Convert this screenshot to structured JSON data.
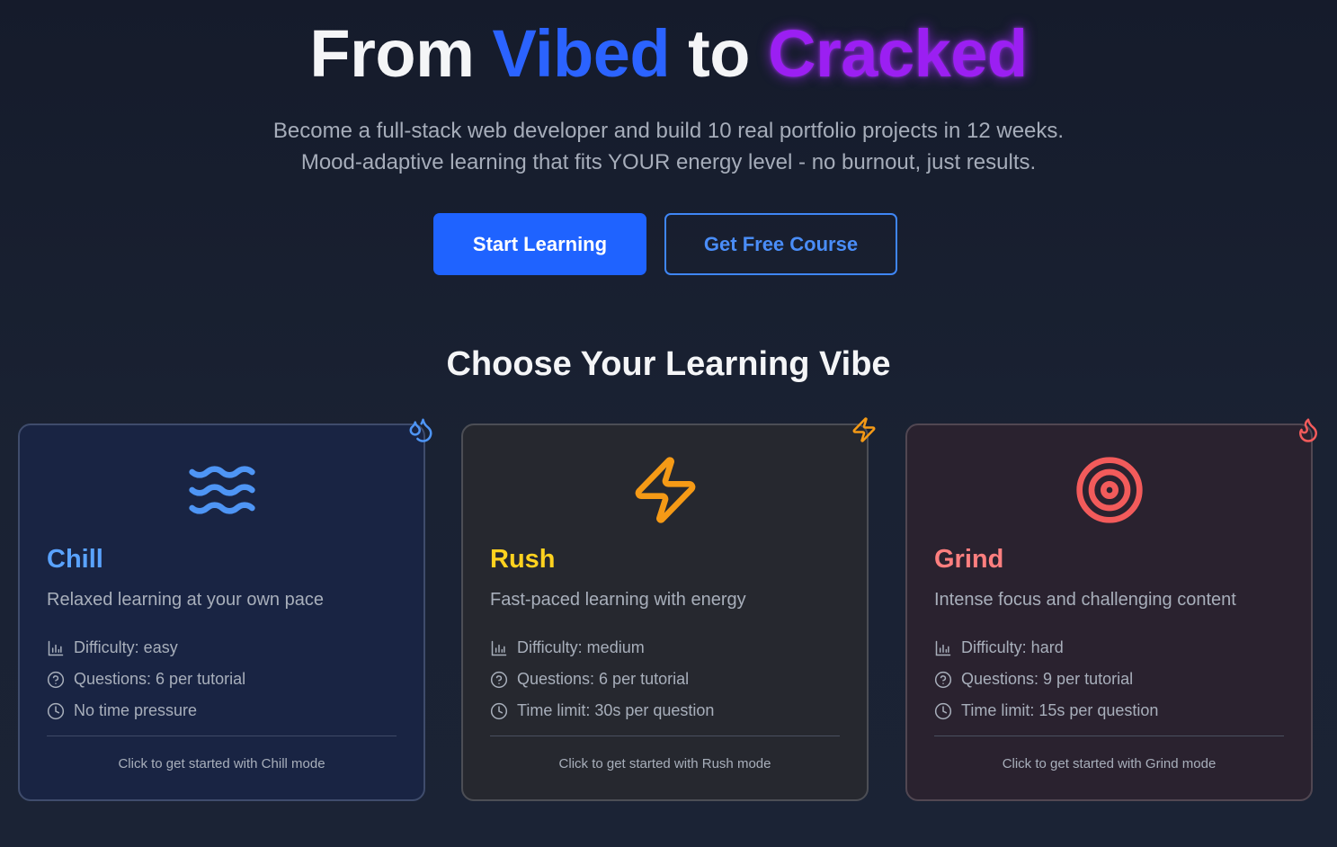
{
  "hero": {
    "title_part1": "From",
    "title_part2": "Vibed",
    "title_part3": "to",
    "title_part4": "Cracked",
    "subtitle_line1": "Become a full-stack web developer and build 10 real portfolio projects in 12 weeks.",
    "subtitle_line2": "Mood-adaptive learning that fits YOUR energy level - no burnout, just results.",
    "primary_button": "Start Learning",
    "secondary_button": "Get Free Course"
  },
  "section": {
    "title": "Choose Your Learning Vibe"
  },
  "modes": [
    {
      "name": "Chill",
      "description": "Relaxed learning at your own pace",
      "difficulty": "Difficulty: easy",
      "questions": "Questions: 6 per tutorial",
      "time": "No time pressure",
      "cta": "Click to get started with Chill mode",
      "icon": "waves-icon",
      "corner_icon": "droplets-icon",
      "accent": "#5aa3ff"
    },
    {
      "name": "Rush",
      "description": "Fast-paced learning with energy",
      "difficulty": "Difficulty: medium",
      "questions": "Questions: 6 per tutorial",
      "time": "Time limit: 30s per question",
      "cta": "Click to get started with Rush mode",
      "icon": "lightning-icon",
      "corner_icon": "lightning-icon",
      "accent": "#ffd21f"
    },
    {
      "name": "Grind",
      "description": "Intense focus and challenging content",
      "difficulty": "Difficulty: hard",
      "questions": "Questions: 9 per tutorial",
      "time": "Time limit: 15s per question",
      "cta": "Click to get started with Grind mode",
      "icon": "target-icon",
      "corner_icon": "flame-icon",
      "accent": "#ff7f7f"
    }
  ],
  "colors": {
    "primary_blue": "#1f63ff",
    "title_purple": "#9b1ff2",
    "chill_icon": "#4e95f5",
    "rush_icon": "#f59a16",
    "grind_icon": "#f25b5b"
  }
}
